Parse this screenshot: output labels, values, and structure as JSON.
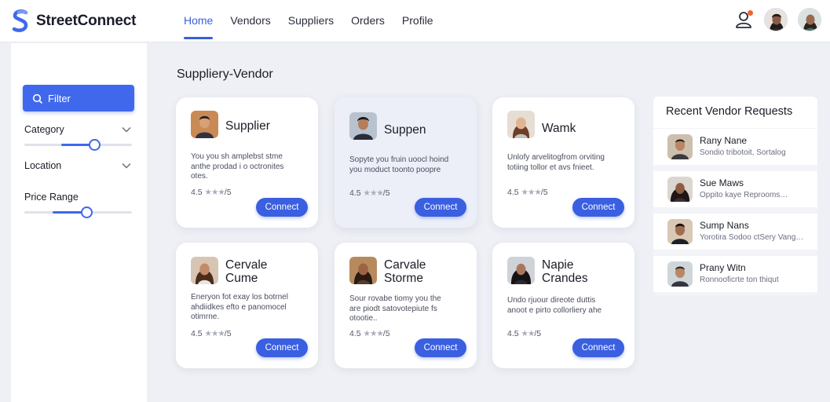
{
  "app": {
    "name": "StreetConnect",
    "accent": "#3f68ec"
  },
  "nav": {
    "items": [
      {
        "label": "Home",
        "active": true
      },
      {
        "label": "Vendors",
        "active": false
      },
      {
        "label": "Suppliers",
        "active": false
      },
      {
        "label": "Orders",
        "active": false
      },
      {
        "label": "Profile",
        "active": false
      }
    ]
  },
  "header_icons": [
    "user-notification-icon",
    "avatar",
    "avatar"
  ],
  "sidebar": {
    "filter_label": "Filter",
    "category_label": "Category",
    "category_slider": 0.65,
    "location_label": "Location",
    "price_label": "Price Range",
    "price_slider": 0.58
  },
  "main": {
    "title": "Suppliery-Vendor",
    "cards": [
      {
        "name_line1": "Supplier",
        "name_line2": "",
        "desc": [
          "You you sh amplebst stme",
          "anthe prodad i o octronites",
          "otes."
        ],
        "rating": "4.5",
        "stars": "★★★",
        "scale": "/5",
        "connect": "Connect"
      },
      {
        "name_line1": "Suppen",
        "name_line2": "",
        "desc": [
          "Sopyte you fruin uoocl hoind",
          "you moduct toonto poopre"
        ],
        "rating": "4.5",
        "stars": "★★★",
        "scale": "/5",
        "connect": "Connect"
      },
      {
        "name_line1": "Wamk",
        "name_line2": "",
        "desc": [
          "Unlofy arvelitogfrom orviting",
          "totiing tollor et avs fnieet."
        ],
        "rating": "4.5",
        "stars": "★★★",
        "scale": "/5",
        "connect": "Connect"
      },
      {
        "name_line1": "Cervale",
        "name_line2": "Cume",
        "desc": [
          "Eneryon fot exay los botrnel",
          "ahdiidkes efto e panomocel",
          "otimrne."
        ],
        "rating": "4.5",
        "stars": "★★★",
        "scale": "/5",
        "connect": "Connect"
      },
      {
        "name_line1": "Carvale",
        "name_line2": "Storme",
        "desc": [
          "Sour rovabe tiomy you the",
          "are piodt satovotepiute fs",
          "otootie.."
        ],
        "rating": "4.5",
        "stars": "★★★",
        "scale": "/5",
        "connect": "Connect"
      },
      {
        "name_line1": "Napie",
        "name_line2": "Crandes",
        "desc": [
          "Undo rjuour direote duttis",
          "anoot e pirto collorliery ahe"
        ],
        "rating": "4.5",
        "stars": "★★",
        "scale": "/5",
        "connect": "Connect"
      }
    ]
  },
  "requests": {
    "title": "Recent Vendor Requests",
    "items": [
      {
        "name": "Rany Nane",
        "sub": "Sondio tribotoit, Sortalog"
      },
      {
        "name": "Sue Maws",
        "sub": "Oppito kaye Reprooms…"
      },
      {
        "name": "Sump Nans",
        "sub": "Yorotira Sodoo ctSery Vang…"
      },
      {
        "name": "Prany Witn",
        "sub": "Ronnooficrte ton thiqut"
      }
    ]
  }
}
